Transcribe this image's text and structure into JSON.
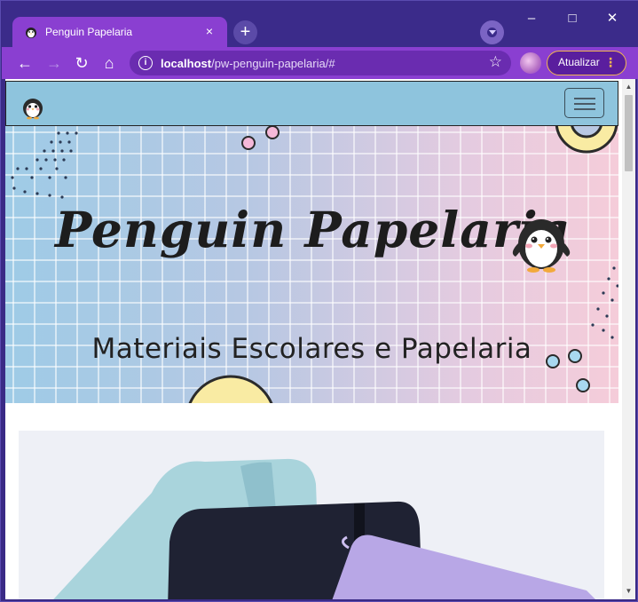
{
  "browser": {
    "tab_title": "Penguin Papelaria",
    "url_host": "localhost",
    "url_path": "/pw-penguin-papelaria/#",
    "update_label": "Atualizar",
    "accent": "#8a3fd1",
    "frame": "#3b2b8a"
  },
  "icons": {
    "close": "×",
    "new_tab": "+",
    "minimize": "–",
    "maximize": "□",
    "win_close": "✕",
    "back": "←",
    "forward": "→",
    "reload": "↻",
    "home": "⌂",
    "info": "i",
    "star": "☆",
    "menu_dots": "⋮",
    "scroll_up": "▲",
    "scroll_down": "▼"
  },
  "site": {
    "hero_title": "Penguin Papelaria",
    "hero_subtitle": "Materiais Escolares e Papelaria",
    "nav_bg": "#8ec4dd"
  }
}
